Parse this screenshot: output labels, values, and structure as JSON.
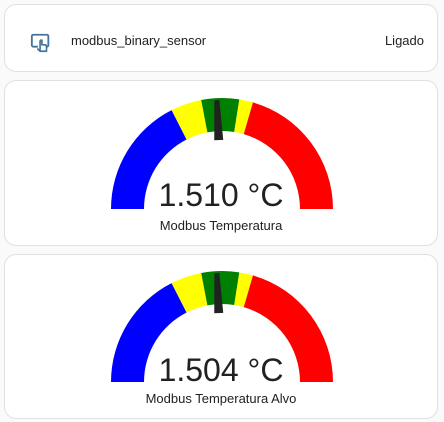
{
  "entity_row": {
    "icon": "hand-pointer-screen-icon",
    "name": "modbus_binary_sensor",
    "state": "Ligado"
  },
  "gauges": [
    {
      "value_text": "1.510 °C",
      "name": "Modbus Temperatura",
      "value": 1.51
    },
    {
      "value_text": "1.504 °C",
      "name": "Modbus Temperatura Alvo",
      "value": 1.504
    }
  ],
  "gauge_segments": [
    {
      "from": 0.0,
      "to": 0.35,
      "color": "#0000ff"
    },
    {
      "from": 0.35,
      "to": 0.44,
      "color": "#ffff00"
    },
    {
      "from": 0.44,
      "to": 0.55,
      "color": "#008000"
    },
    {
      "from": 0.55,
      "to": 0.59,
      "color": "#ffff00"
    },
    {
      "from": 0.59,
      "to": 1.0,
      "color": "#ff0000"
    }
  ],
  "colors": {
    "needle": "#222222",
    "icon": "#44739e"
  }
}
